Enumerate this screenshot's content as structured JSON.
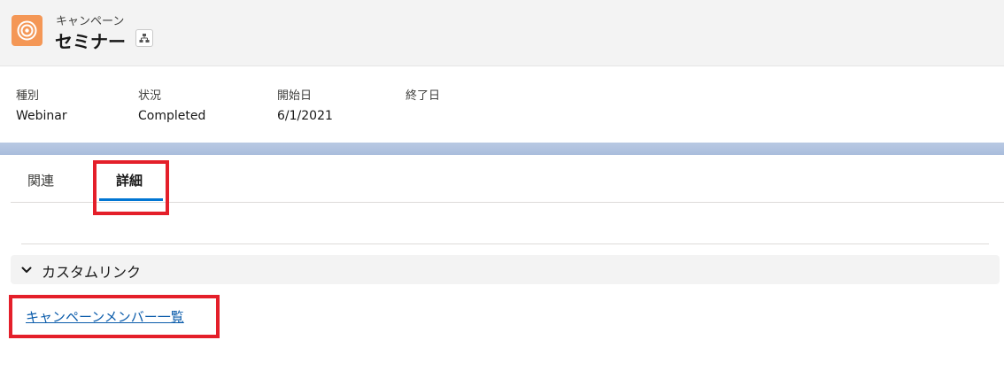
{
  "header": {
    "object_label": "キャンペーン",
    "record_name": "セミナー",
    "icon": "campaign-target-icon",
    "hierarchy_icon": "hierarchy-icon",
    "accent_color": "#f49756"
  },
  "highlights": [
    {
      "label": "種別",
      "value": "Webinar"
    },
    {
      "label": "状況",
      "value": "Completed"
    },
    {
      "label": "開始日",
      "value": "6/1/2021"
    },
    {
      "label": "終了日",
      "value": ""
    }
  ],
  "tabs": [
    {
      "label": "関連",
      "active": false
    },
    {
      "label": "詳細",
      "active": true
    }
  ],
  "section": {
    "title": "カスタムリンク",
    "expanded": true,
    "links": [
      "キャンペーンメンバー一覧"
    ]
  },
  "colors": {
    "link": "#0b5cab",
    "tab_active": "#0176d3",
    "annotation_box": "#e41f2a"
  }
}
